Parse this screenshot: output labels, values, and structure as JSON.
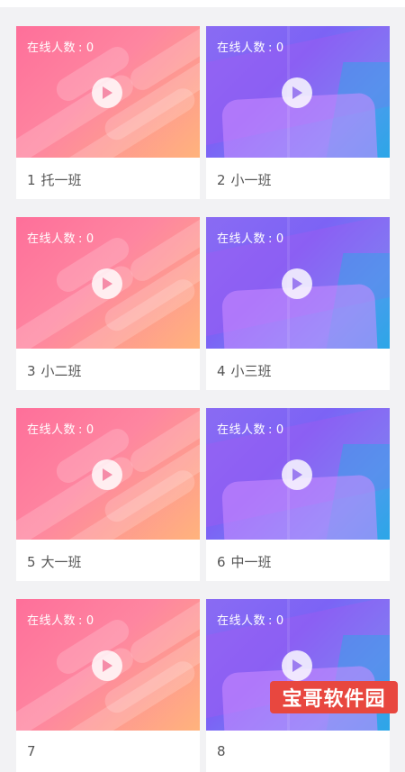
{
  "online_label": "在线人数",
  "online_sep": ":",
  "classes": [
    {
      "number": "1",
      "name": "托一班",
      "online": "0",
      "theme": "pink"
    },
    {
      "number": "2",
      "name": "小一班",
      "online": "0",
      "theme": "purple"
    },
    {
      "number": "3",
      "name": "小二班",
      "online": "0",
      "theme": "pink"
    },
    {
      "number": "4",
      "name": "小三班",
      "online": "0",
      "theme": "purple"
    },
    {
      "number": "5",
      "name": "大一班",
      "online": "0",
      "theme": "pink"
    },
    {
      "number": "6",
      "name": "中一班",
      "online": "0",
      "theme": "purple"
    },
    {
      "number": "7",
      "name": "",
      "online": "0",
      "theme": "pink"
    },
    {
      "number": "8",
      "name": "",
      "online": "0",
      "theme": "purple"
    }
  ],
  "icons": {
    "play": "play-icon"
  },
  "colors": {
    "background": "#f2f2f4",
    "pink_start": "#fe6f9a",
    "pink_end": "#ffb37c",
    "purple_start": "#8a6bf3",
    "purple_end": "#2fa3e8",
    "play_triangle_pink": "#f58ca8",
    "play_triangle_purple": "#9b7cf0",
    "watermark": "#e8473f"
  },
  "watermark": {
    "text": "宝哥软件园"
  }
}
